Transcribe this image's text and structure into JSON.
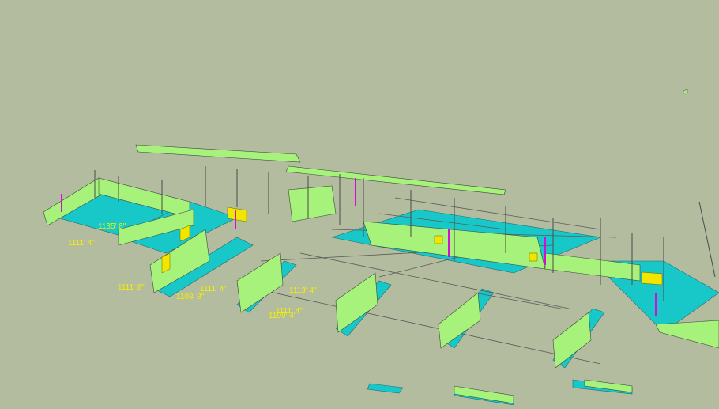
{
  "colors": {
    "background": "#b3bc9e",
    "wall_face": "#a6f27a",
    "wall_side": "#6fb33f",
    "footing": "#18c8c8",
    "highlight": "#f2e600",
    "accent": "#d010d0",
    "edge": "#3a4a3a"
  },
  "elevation_labels": [
    {
      "id": "l1",
      "text": "1135' 8\""
    },
    {
      "id": "l2",
      "text": "1111' 4\""
    },
    {
      "id": "l3",
      "text": "1111' 8\""
    },
    {
      "id": "l4",
      "text": "1108' 8\""
    },
    {
      "id": "l5",
      "text": "1111' 4\""
    },
    {
      "id": "l6",
      "text": "1113' 4\""
    },
    {
      "id": "l7",
      "text": "1111' 4\""
    },
    {
      "id": "l8",
      "text": "1109' 4\""
    }
  ]
}
